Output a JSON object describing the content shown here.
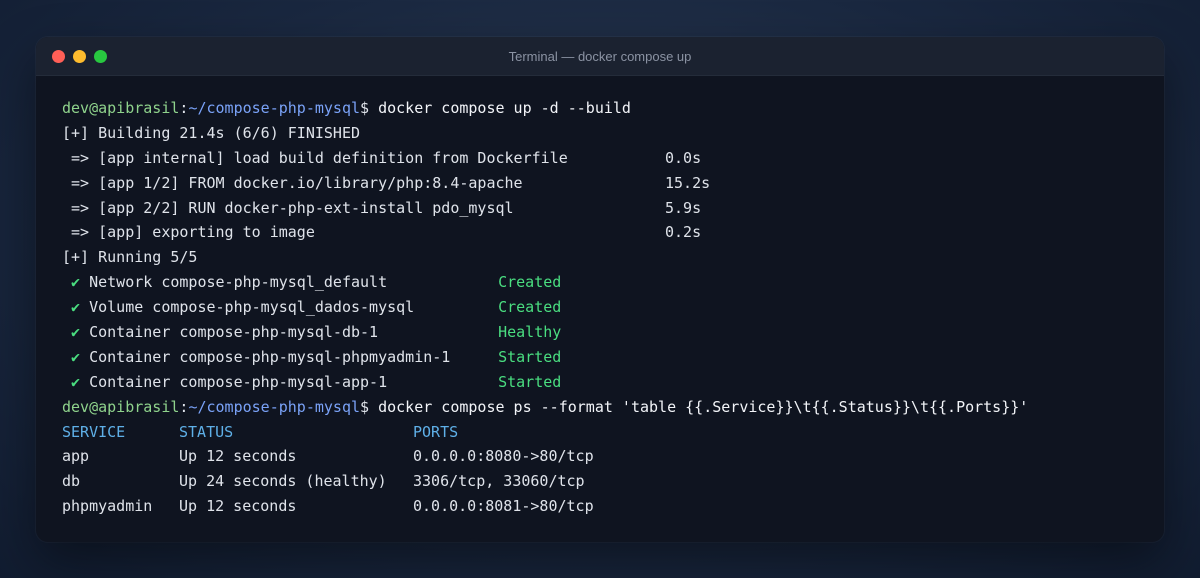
{
  "window": {
    "title": "Terminal — docker compose up",
    "colors": {
      "close": "#ff5f57",
      "minimize": "#febc2e",
      "maximize": "#28c840"
    }
  },
  "terminal": {
    "prompts": [
      {
        "user": "dev@apibrasil",
        "sep": ":",
        "path": "~/compose-php-mysql",
        "dollar": "$",
        "command": "docker compose up -d --build"
      },
      {
        "user": "dev@apibrasil",
        "sep": ":",
        "path": "~/compose-php-mysql",
        "dollar": "$",
        "command": "docker compose ps --format 'table {{.Service}}\\t{{.Status}}\\t{{.Ports}}'"
      }
    ],
    "build_header": "[+] Building 21.4s (6/6) FINISHED",
    "build_steps": [
      {
        "text": " => [app internal] load build definition from Dockerfile",
        "time": "0.0s"
      },
      {
        "text": " => [app 1/2] FROM docker.io/library/php:8.4-apache",
        "time": "15.2s"
      },
      {
        "text": " => [app 2/2] RUN docker-php-ext-install pdo_mysql",
        "time": "5.9s"
      },
      {
        "text": " => [app] exporting to image",
        "time": "0.2s"
      }
    ],
    "running_header": "[+] Running 5/5",
    "resources": [
      {
        "check": "✔",
        "label": "Network compose-php-mysql_default",
        "status": "Created"
      },
      {
        "check": "✔",
        "label": "Volume compose-php-mysql_dados-mysql",
        "status": "Created"
      },
      {
        "check": "✔",
        "label": "Container compose-php-mysql-db-1",
        "status": "Healthy"
      },
      {
        "check": "✔",
        "label": "Container compose-php-mysql-phpmyadmin-1",
        "status": "Started"
      },
      {
        "check": "✔",
        "label": "Container compose-php-mysql-app-1",
        "status": "Started"
      }
    ],
    "ps_table": {
      "headers": [
        "SERVICE",
        "STATUS",
        "PORTS"
      ],
      "rows": [
        [
          "app",
          "Up 12 seconds",
          "0.0.0.0:8080->80/tcp"
        ],
        [
          "db",
          "Up 24 seconds (healthy)",
          "3306/tcp, 33060/tcp"
        ],
        [
          "phpmyadmin",
          "Up 12 seconds",
          "0.0.0.0:8081->80/tcp"
        ]
      ]
    }
  }
}
